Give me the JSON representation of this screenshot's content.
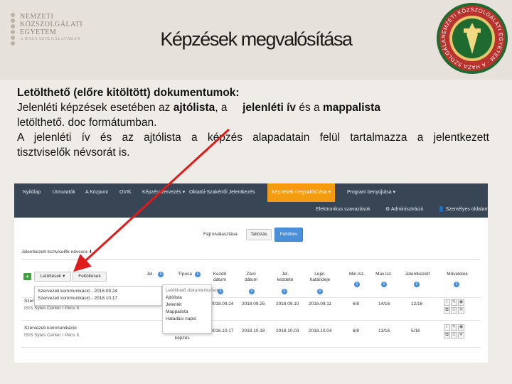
{
  "header": {
    "university_logo_lines": [
      "NEMZETI",
      "KÖZSZOLGÁLATI",
      "EGYETEM"
    ],
    "university_logo_sub": "A HAZA SZOLGÁLATÁBAN",
    "title": "Képzések megvalósítása",
    "seal_text": "NEMZETI KÖZSZOLGÁLATI EGYETEM · A HAZA SZOLGÁLATÁBAN"
  },
  "body": {
    "heading": "Letölthető (előre kitöltött) dokumentumok:",
    "line2_a": "Jelenléti képzések esetében az ",
    "line2_b": "ajtólista",
    "line2_c": ", a ",
    "line2_d": "jelenléti ív",
    "line2_e": " és a ",
    "line2_f": "mappalista",
    "line3": "letölthető. doc formátumban.",
    "line4": "A jelenléti ív és az ajtólista a képzés alapadatain felül tartalmazza a jelentkezett",
    "line5": "tisztviselők névsorát is."
  },
  "app": {
    "nav": [
      "Nyitólap",
      "Útmutatók",
      "A Központ",
      "OVIK",
      "Képzésszervezés ▾",
      "Oktatói-Szakértői Jelentkezés",
      "Képzések megvalósítása ▾",
      "Program benyújtása ▾"
    ],
    "subnav": [
      "Elektronikus szavazások",
      "⚙ Adminisztráció",
      "👤 Személyes oldalam"
    ],
    "filter_label": "Fájl kiválasztása",
    "filter_btn": "Tallózás",
    "upload_btn": "Feltöltés",
    "breadcrumb": "Jelentkezett tisztviselők névsora",
    "download_btn": "Letöltések ▾",
    "upload_btn2": "Feltöltések",
    "columns": [
      "Jel.",
      "Típusa",
      "Kezdő dátum",
      "Záró dátum",
      "Jel. kezdete",
      "Lejel. határideje",
      "Min.lsz.",
      "Max.lsz.",
      "Jelentkezett",
      "Műveletek"
    ],
    "row1": {
      "name": "Szervezeti kommunikáció",
      "sub": "ISIS Sytes Center / Pécs II.",
      "kezdo": "2018.09.24",
      "zaro": "2018.09.25",
      "jel": "2018.09.10",
      "lejel": "2018.09.11",
      "min": "6/8",
      "max": "14/16",
      "jelentkezett": "12/16"
    },
    "row2": {
      "name": "Szervezeti kommunikáció",
      "sub": "ISIS Sytes Center / Pécs II.",
      "type": "képzés",
      "kezdo": "2018.10.17",
      "zaro": "2018.10.18",
      "jel": "2018.10.03",
      "lejel": "2018.10.04",
      "min": "6/8",
      "max": "13/16",
      "jelentkezett": "5/16"
    },
    "dropdown_left": [
      "Szervezeti kommunikáció - 2018.09.24",
      "Szervezeti kommunikáció - 2018.10.17"
    ],
    "dropdown_right": [
      "Letölthető dokumentumok",
      "Ajtólista",
      "Jelenlét",
      "Mappalista",
      "Haladási napló"
    ]
  },
  "colors": {
    "nav_bg": "#374555",
    "nav_active": "#f39c12",
    "arrow": "#e01b1b"
  }
}
